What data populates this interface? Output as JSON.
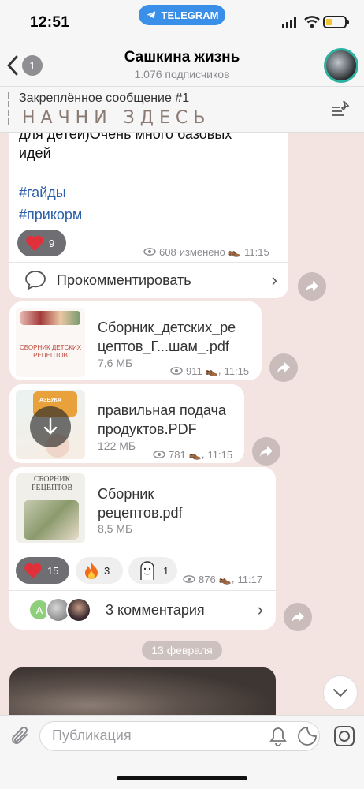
{
  "status_bar": {
    "time": "12:51",
    "app_pill": "TELEGRAM"
  },
  "header": {
    "back_count": "1",
    "title": "Сашкина жизнь",
    "subtitle": "1.076 подписчиков"
  },
  "pinned": {
    "label": "Закреплённое сообщение #1",
    "text": "НАЧНИ ЗДЕСЬ"
  },
  "message1": {
    "partial_line": "для детей)Очень много базовых",
    "line2": "идей",
    "hashtags": [
      "#гайды",
      "#прикорм"
    ],
    "reaction_count": "9",
    "views": "608",
    "edited": "изменено",
    "time": "11:15",
    "comment_label": "Прокомментировать"
  },
  "files": [
    {
      "name_line1": "Сборник_детских_ре",
      "name_line2": "цептов_Г...шам_.pdf",
      "size": "7,6 МБ",
      "views": "911",
      "time": "11:15",
      "thumb_caption": "СБОРНИК ДЕТСКИХ РЕЦЕПТОВ"
    },
    {
      "name_line1": "правильная подача",
      "name_line2": "продуктов.PDF",
      "size": "122 МБ",
      "views": "781",
      "time": "11:15",
      "thumb_caption": "АЗБУКА"
    },
    {
      "name_line1": "Сборник",
      "name_line2": "рецептов.pdf",
      "size": "8,5 МБ",
      "views": "",
      "time": "",
      "thumb_caption": "СБОРНИК РЕЦЕПТОВ"
    }
  ],
  "message_last": {
    "reactions": [
      {
        "emoji": "heart",
        "count": "15"
      },
      {
        "emoji": "fire",
        "count": "3"
      },
      {
        "emoji": "sticker",
        "count": "1"
      }
    ],
    "views": "876",
    "time": "11:17",
    "comments_label": "3 комментария",
    "commenter_initial": "А"
  },
  "date_separator": "13 февраля",
  "composer": {
    "placeholder": "Публикация"
  },
  "colors": {
    "accent": "#2b5fa8",
    "telegram": "#3a8fe8",
    "heart": "#e0313b"
  }
}
